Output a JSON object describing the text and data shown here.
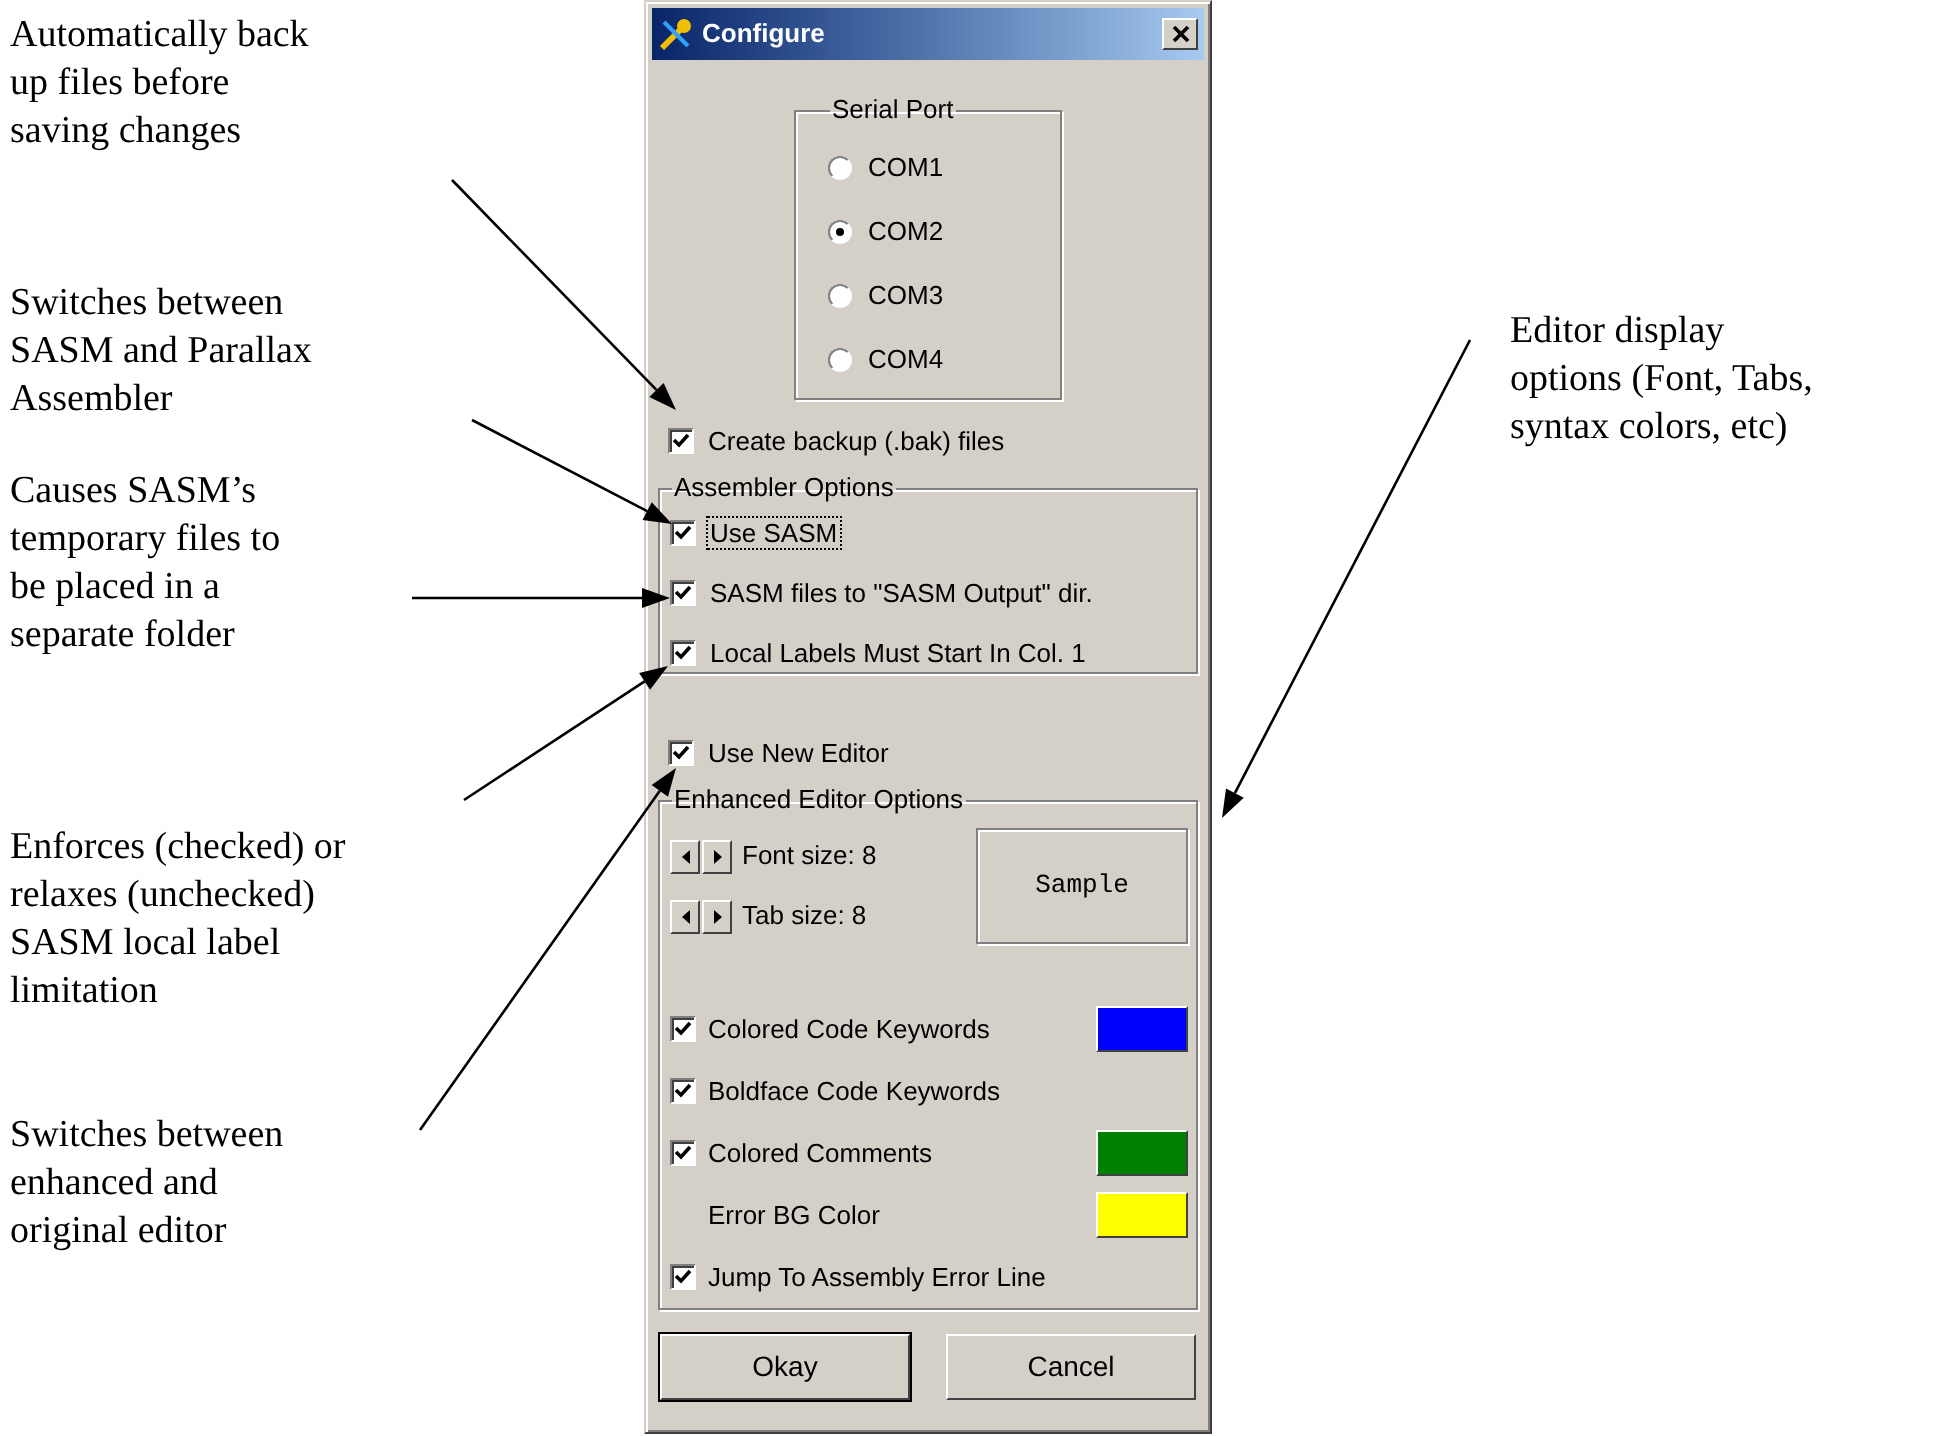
{
  "annotations_left": [
    {
      "text": "Automatically back\nup files before\nsaving changes"
    },
    {
      "text": "Switches between\nSASM and Parallax\nAssembler"
    },
    {
      "text": "Causes SASM’s\ntemporary files to\nbe placed in a\nseparate folder"
    },
    {
      "text": "Enforces (checked) or\nrelaxes (unchecked)\nSASM local label\nlimitation"
    },
    {
      "text": "Switches between\nenhanced and\noriginal editor"
    }
  ],
  "annotation_right": {
    "text": "Editor display\noptions (Font, Tabs,\nsyntax colors, etc)"
  },
  "window": {
    "title": "Configure"
  },
  "serial_port": {
    "label": "Serial Port",
    "options": [
      {
        "label": "COM1",
        "selected": false
      },
      {
        "label": "COM2",
        "selected": true
      },
      {
        "label": "COM3",
        "selected": false
      },
      {
        "label": "COM4",
        "selected": false
      }
    ]
  },
  "create_backup": {
    "label": "Create backup (.bak) files",
    "checked": true
  },
  "assembler_options": {
    "label": "Assembler Options",
    "items": [
      {
        "label": "Use SASM",
        "checked": true,
        "focused": true
      },
      {
        "label": "SASM files to \"SASM Output\" dir.",
        "checked": true,
        "focused": false
      },
      {
        "label": "Local Labels Must Start In Col. 1",
        "checked": true,
        "focused": false
      }
    ]
  },
  "use_new_editor": {
    "label": "Use New Editor",
    "checked": true
  },
  "enhanced_editor_options": {
    "label": "Enhanced Editor Options",
    "spinners": [
      {
        "label": "Font size: 8"
      },
      {
        "label": "Tab size: 8"
      }
    ],
    "sample": "Sample",
    "items": [
      {
        "kind": "check",
        "label": "Colored Code Keywords",
        "checked": true,
        "color": "#0000ff"
      },
      {
        "kind": "check",
        "label": "Boldface Code Keywords",
        "checked": true
      },
      {
        "kind": "check",
        "label": "Colored Comments",
        "checked": true,
        "color": "#008000"
      },
      {
        "kind": "color",
        "label": "Error BG Color",
        "color": "#ffff00"
      },
      {
        "kind": "check",
        "label": "Jump To Assembly Error Line",
        "checked": true
      }
    ]
  },
  "buttons": [
    {
      "label": "Okay"
    },
    {
      "label": "Cancel"
    }
  ]
}
